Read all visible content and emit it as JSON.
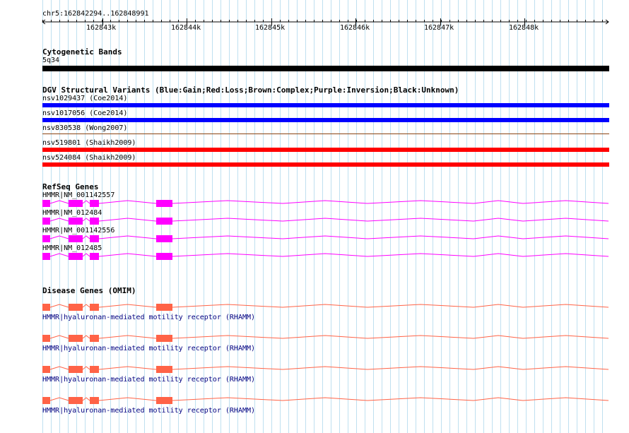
{
  "ruler": {
    "coordinate": "chr5:162842294..162848991",
    "ticks": [
      "162843k",
      "162844k",
      "162845k",
      "162846k",
      "162847k",
      "162848k"
    ]
  },
  "cytoband": {
    "title": "Cytogenetic Bands",
    "band": "5q34",
    "color": "#000000"
  },
  "dgv": {
    "title": "DGV Structural Variants (Blue:Gain;Red:Loss;Brown:Complex;Purple:Inversion;Black:Unknown)",
    "variants": [
      {
        "label": "nsv1029437 (Coe2014)",
        "color": "#0000ff"
      },
      {
        "label": "nsv1017056 (Coe2014)",
        "color": "#0000ff"
      },
      {
        "label": "nsv830538 (Wong2007)",
        "color": "#8b4513"
      },
      {
        "label": "nsv519801 (Shaikh2009)",
        "color": "#ff0000"
      },
      {
        "label": "nsv524084 (Shaikh2009)",
        "color": "#ff0000"
      }
    ]
  },
  "refseq": {
    "title": "RefSeq Genes",
    "color": "#ff00ff",
    "genes": [
      {
        "label": "HMMR|NM_001142557"
      },
      {
        "label": "HMMR|NM_012484"
      },
      {
        "label": "HMMR|NM_001142556"
      },
      {
        "label": "HMMR|NM_012485"
      }
    ]
  },
  "omim": {
    "title": "Disease Genes (OMIM)",
    "color": "#ff6347",
    "genes": [
      {
        "label": "HMMR|hyaluronan-mediated motility receptor (RHAMM)"
      },
      {
        "label": "HMMR|hyaluronan-mediated motility receptor (RHAMM)"
      },
      {
        "label": "HMMR|hyaluronan-mediated motility receptor (RHAMM)"
      },
      {
        "label": "HMMR|hyaluronan-mediated motility receptor (RHAMM)"
      }
    ]
  }
}
